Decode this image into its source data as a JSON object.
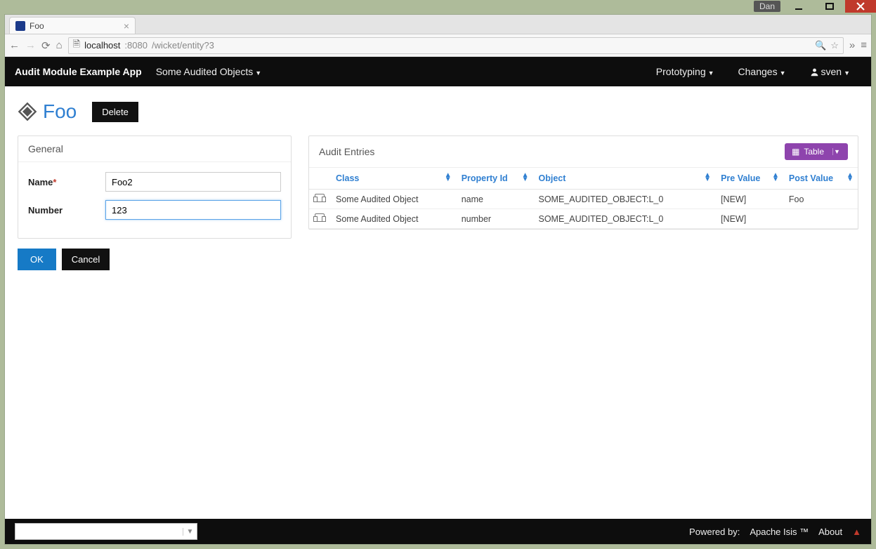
{
  "os": {
    "user": "Dan"
  },
  "browser": {
    "tab_title": "Foo",
    "url_host": "localhost",
    "url_port": ":8080",
    "url_path": "/wicket/entity?3"
  },
  "nav": {
    "brand": "Audit Module Example App",
    "menu1": "Some Audited Objects",
    "right": {
      "prototyping": "Prototyping",
      "changes": "Changes",
      "user": "sven"
    }
  },
  "entity": {
    "title": "Foo",
    "delete_label": "Delete"
  },
  "form": {
    "panel_title": "General",
    "name_label": "Name",
    "name_value": "Foo2",
    "number_label": "Number",
    "number_value": "123",
    "ok_label": "OK",
    "cancel_label": "Cancel"
  },
  "audit": {
    "panel_title": "Audit Entries",
    "table_button": "Table",
    "cols": {
      "class": "Class",
      "property": "Property Id",
      "object": "Object",
      "pre": "Pre Value",
      "post": "Post Value"
    },
    "rows": [
      {
        "class": "Some Audited Object",
        "property": "name",
        "object": "SOME_AUDITED_OBJECT:L_0",
        "pre": "[NEW]",
        "post": "Foo"
      },
      {
        "class": "Some Audited Object",
        "property": "number",
        "object": "SOME_AUDITED_OBJECT:L_0",
        "pre": "[NEW]",
        "post": ""
      }
    ]
  },
  "footer": {
    "powered_by": "Powered by:",
    "isis": "Apache Isis ™",
    "about": "About"
  }
}
